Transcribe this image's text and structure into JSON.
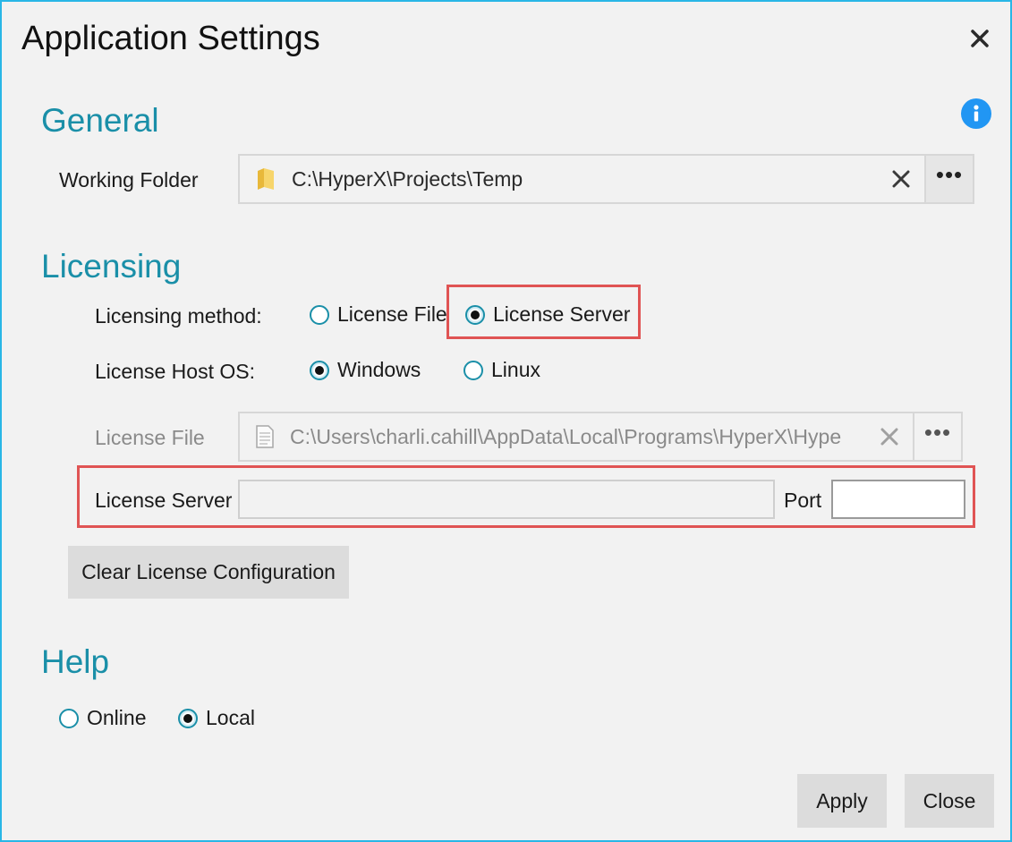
{
  "window": {
    "title": "Application Settings"
  },
  "general": {
    "heading": "General",
    "working_folder_label": "Working Folder",
    "working_folder_value": "C:\\HyperX\\Projects\\Temp"
  },
  "licensing": {
    "heading": "Licensing",
    "method_label": "Licensing method:",
    "method_options": [
      "License File",
      "License Server"
    ],
    "method_selected": "License Server",
    "host_os_label": "License Host OS:",
    "host_os_options": [
      "Windows",
      "Linux"
    ],
    "host_os_selected": "Windows",
    "license_file_label": "License File",
    "license_file_value": "C:\\Users\\charli.cahill\\AppData\\Local\\Programs\\HyperX\\Hype",
    "license_server_label": "License Server",
    "license_server_value": "",
    "port_label": "Port",
    "port_value": "",
    "clear_button": "Clear License Configuration"
  },
  "help": {
    "heading": "Help",
    "options": [
      "Online",
      "Local"
    ],
    "selected": "Local"
  },
  "footer": {
    "apply": "Apply",
    "close": "Close"
  },
  "colors": {
    "accent": "#1a8fa8",
    "highlight": "#e05454",
    "border": "#29b6e6",
    "info": "#2196f3"
  }
}
